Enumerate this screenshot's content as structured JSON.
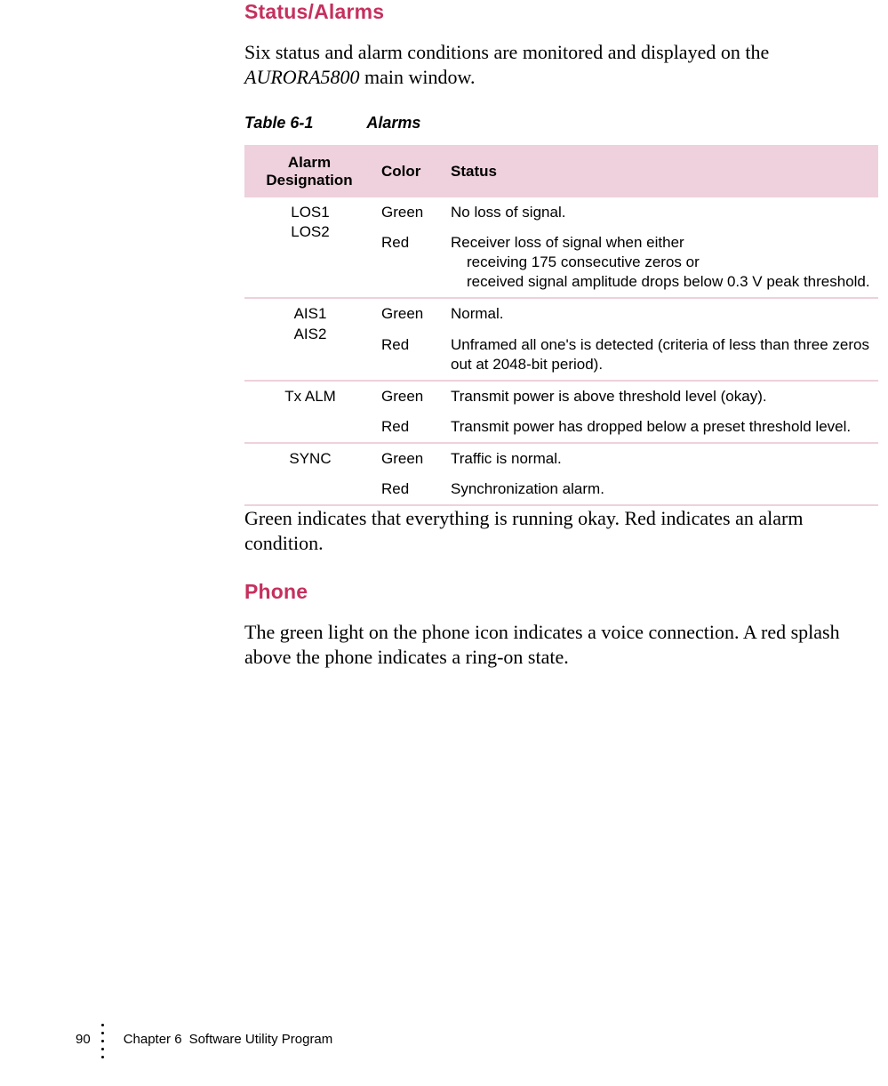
{
  "section1": {
    "heading": "Status/Alarms",
    "intro_a": "Six status and alarm conditions are monitored and displayed on the ",
    "intro_em": "AURORA5800",
    "intro_b": " main window."
  },
  "table": {
    "caption_num": "Table 6-1",
    "caption_title": "Alarms",
    "headers": {
      "designation_l1": "Alarm",
      "designation_l2": "Designation",
      "color": "Color",
      "status": "Status"
    },
    "groups": [
      {
        "designation": "LOS1\nLOS2",
        "rows": [
          {
            "color": "Green",
            "status": "No loss of signal."
          },
          {
            "color": "Red",
            "status": "Receiver loss of signal when either",
            "sub": [
              "receiving 175 consecutive zeros or",
              "received signal amplitude drops below 0.3 V peak threshold."
            ]
          }
        ]
      },
      {
        "designation": "AIS1\nAIS2",
        "rows": [
          {
            "color": "Green",
            "status": "Normal."
          },
          {
            "color": "Red",
            "status": "Unframed all one's is detected (criteria of less than three zeros out at 2048-bit period)."
          }
        ]
      },
      {
        "designation": "Tx ALM",
        "rows": [
          {
            "color": "Green",
            "status": "Transmit power is above threshold level (okay)."
          },
          {
            "color": "Red",
            "status": "Transmit power has dropped below a preset threshold level."
          }
        ]
      },
      {
        "designation": "SYNC",
        "rows": [
          {
            "color": "Green",
            "status": "Traffic is normal."
          },
          {
            "color": "Red",
            "status": "Synchronization alarm."
          }
        ]
      }
    ]
  },
  "after_table": "Green indicates that everything is running okay. Red indicates an alarm condition.",
  "section2": {
    "heading": "Phone",
    "body": "The green light on the phone icon indicates a voice connection. A red splash above the phone indicates a ring-on state."
  },
  "footer": {
    "page": "90",
    "chapter": "Chapter 6",
    "title": "Software Utility Program"
  }
}
